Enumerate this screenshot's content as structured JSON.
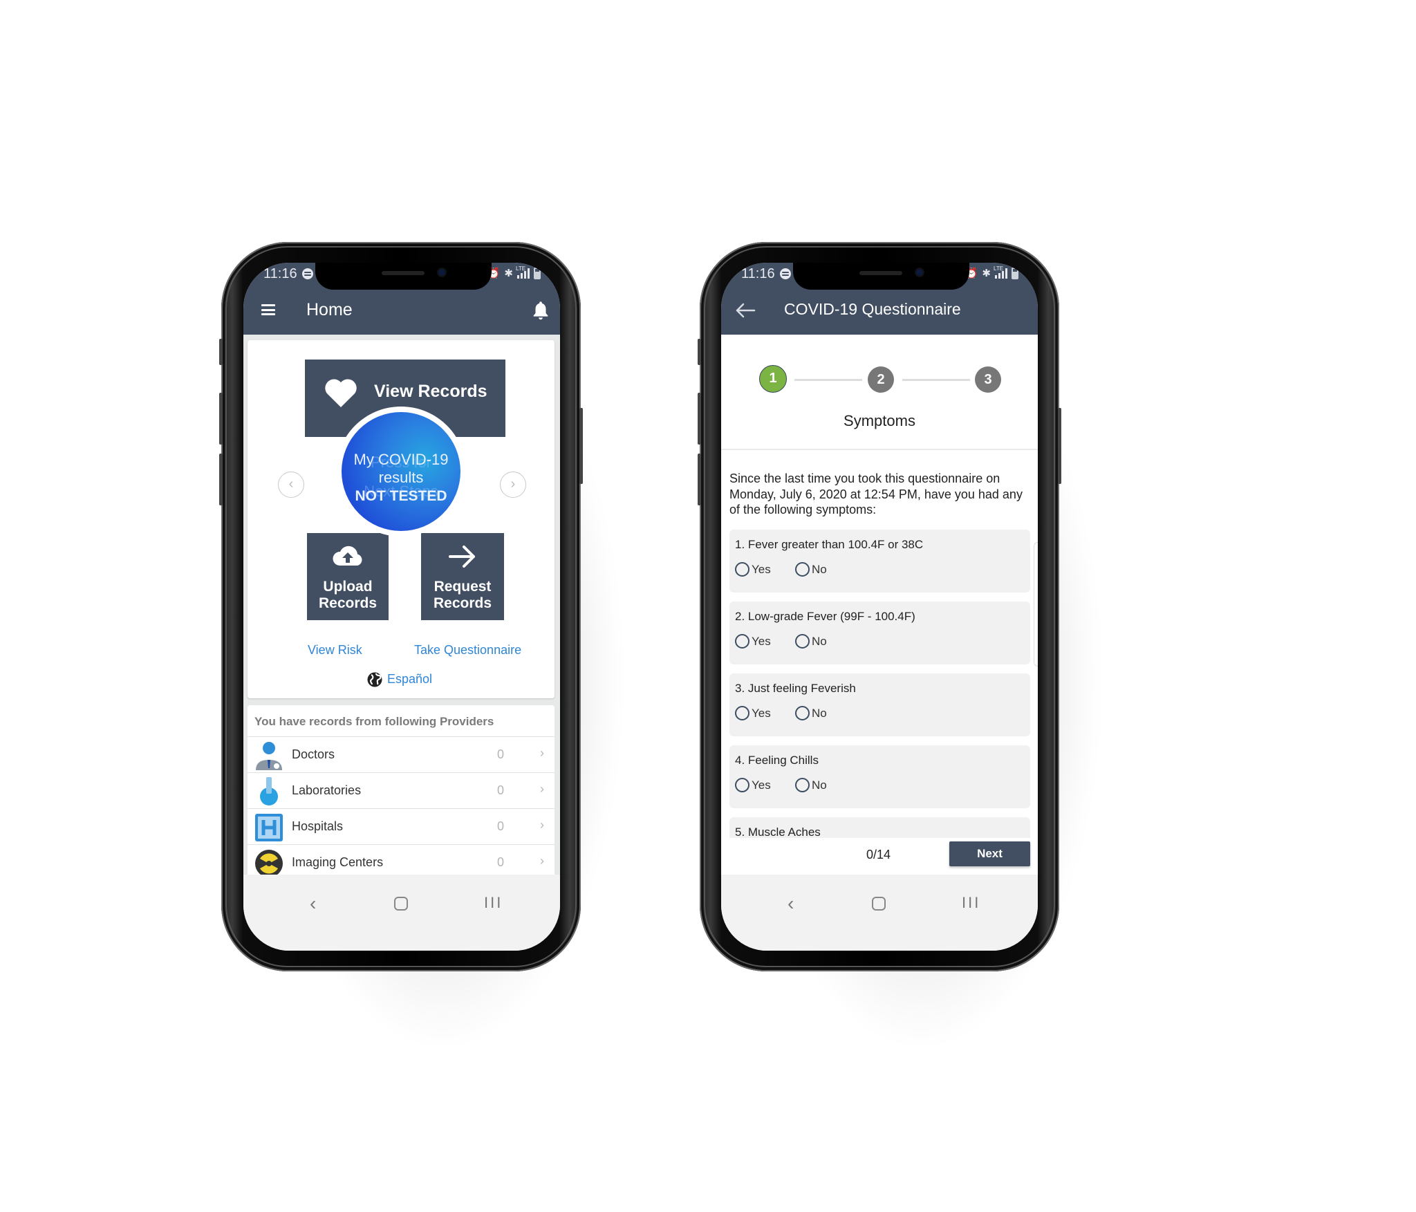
{
  "status_bar": {
    "time": "11:16",
    "network": "LTE"
  },
  "home": {
    "title": "Home",
    "view_records": "View Records",
    "covid_result": {
      "line1": "My COVID-19",
      "line2": "results",
      "status": "NOT TESTED",
      "ghost1": "Press for",
      "ghost2": "Next Steps"
    },
    "upload_records": [
      "Upload",
      "Records"
    ],
    "request_records": [
      "Request",
      "Records"
    ],
    "prev_arrow": "‹",
    "next_arrow": "›",
    "view_risk": "View Risk",
    "take_questionnaire": "Take Questionnaire",
    "language": "Español",
    "providers": {
      "header": "You have records from following Providers",
      "items": [
        {
          "name": "Doctors",
          "count": "0",
          "icon": "doctor-icon"
        },
        {
          "name": "Laboratories",
          "count": "0",
          "icon": "flask-icon"
        },
        {
          "name": "Hospitals",
          "count": "0",
          "icon": "hospital-icon"
        },
        {
          "name": "Imaging Centers",
          "count": "0",
          "icon": "radiation-icon"
        }
      ]
    }
  },
  "questionnaire": {
    "title": "COVID-19 Questionnaire",
    "steps": [
      "1",
      "2",
      "3"
    ],
    "active_step": 1,
    "section_title": "Symptoms",
    "intro": "Since the last time you took this questionnaire on Monday, July 6, 2020 at 12:54 PM, have you had any of the following symptoms:",
    "options": [
      "Yes",
      "No"
    ],
    "questions": [
      "1. Fever greater than 100.4F or 38C",
      "2. Low-grade Fever (99F - 100.4F)",
      "3. Just feeling Feverish",
      "4. Feeling Chills",
      "5. Muscle Aches"
    ],
    "progress": "0/14",
    "next_label": "Next"
  },
  "colors": {
    "app_bar": "#424f63",
    "accent_link": "#2f86d6",
    "step_active": "#7bb443",
    "step_inactive": "#777777"
  }
}
